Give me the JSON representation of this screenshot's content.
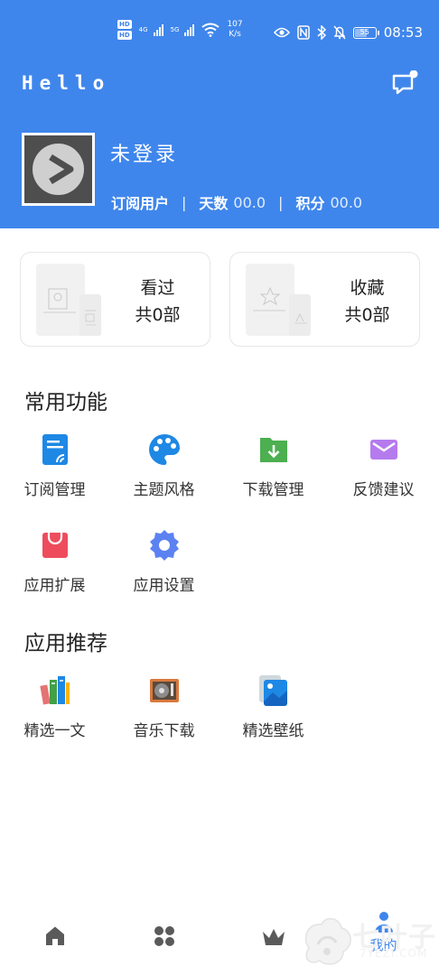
{
  "status_bar": {
    "network_labels": [
      "HD",
      "HD"
    ],
    "net_gen_1": "4G",
    "net_gen_2": "5G",
    "speed_value": "107",
    "speed_unit": "K/s",
    "battery": "55",
    "time": "08:53"
  },
  "header": {
    "app_greeting": "Hello",
    "login_status": "未登录",
    "user_type": "订阅用户",
    "days_label": "天数",
    "days_value": "00.0",
    "points_label": "积分",
    "points_value": "00.0",
    "separator": "|"
  },
  "cards": [
    {
      "title": "看过",
      "count": "共0部"
    },
    {
      "title": "收藏",
      "count": "共0部"
    }
  ],
  "sections": {
    "common": {
      "title": "常用功能",
      "items": [
        {
          "label": "订阅管理",
          "icon": "subscription-icon"
        },
        {
          "label": "主题风格",
          "icon": "palette-icon"
        },
        {
          "label": "下载管理",
          "icon": "download-folder-icon"
        },
        {
          "label": "反馈建议",
          "icon": "mail-icon"
        },
        {
          "label": "应用扩展",
          "icon": "shopping-bag-icon"
        },
        {
          "label": "应用设置",
          "icon": "settings-gear-icon"
        }
      ]
    },
    "recommend": {
      "title": "应用推荐",
      "items": [
        {
          "label": "精选一文",
          "icon": "books-icon"
        },
        {
          "label": "音乐下载",
          "icon": "music-player-icon"
        },
        {
          "label": "精选壁纸",
          "icon": "wallpaper-icon"
        }
      ]
    }
  },
  "tabbar": {
    "tabs": [
      {
        "icon": "home-icon",
        "label": ""
      },
      {
        "icon": "apps-grid-icon",
        "label": ""
      },
      {
        "icon": "crown-icon",
        "label": ""
      },
      {
        "icon": "profile-icon",
        "label": "我的"
      }
    ]
  },
  "watermark": {
    "text": "七叶子",
    "sub": "7YEZI.COM"
  },
  "colors": {
    "primary": "#3f86ec",
    "header_text": "#ffffff",
    "tab_inactive": "#5a5a5a"
  }
}
